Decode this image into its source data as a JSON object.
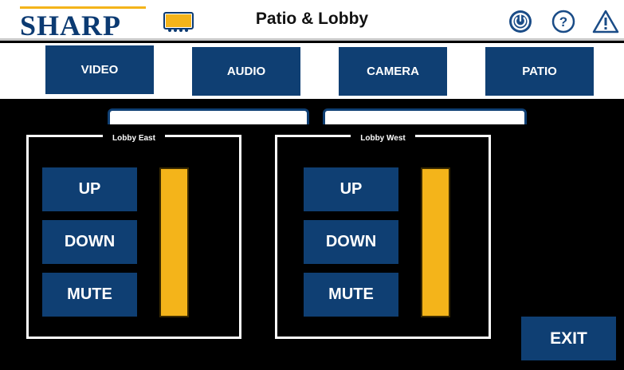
{
  "colors": {
    "button_blue": "#0f3f73",
    "logo_blue": "#0b3a72",
    "accent_gold": "#f4b41a",
    "meter_fill": "#f4b41a"
  },
  "header": {
    "logo_text": "SHARP",
    "title": "Patio & Lobby",
    "icons": [
      "projector-icon",
      "power-icon",
      "help-icon",
      "warning-icon"
    ]
  },
  "tabs": [
    {
      "label": "VIDEO"
    },
    {
      "label": "AUDIO"
    },
    {
      "label": "CAMERA"
    },
    {
      "label": "PATIO"
    }
  ],
  "zones": [
    {
      "name": "Lobby East",
      "up": "UP",
      "down": "DOWN",
      "mute": "MUTE",
      "level": 1.0
    },
    {
      "name": "Lobby West",
      "up": "UP",
      "down": "DOWN",
      "mute": "MUTE",
      "level": 1.0
    }
  ],
  "exit_label": "EXIT"
}
